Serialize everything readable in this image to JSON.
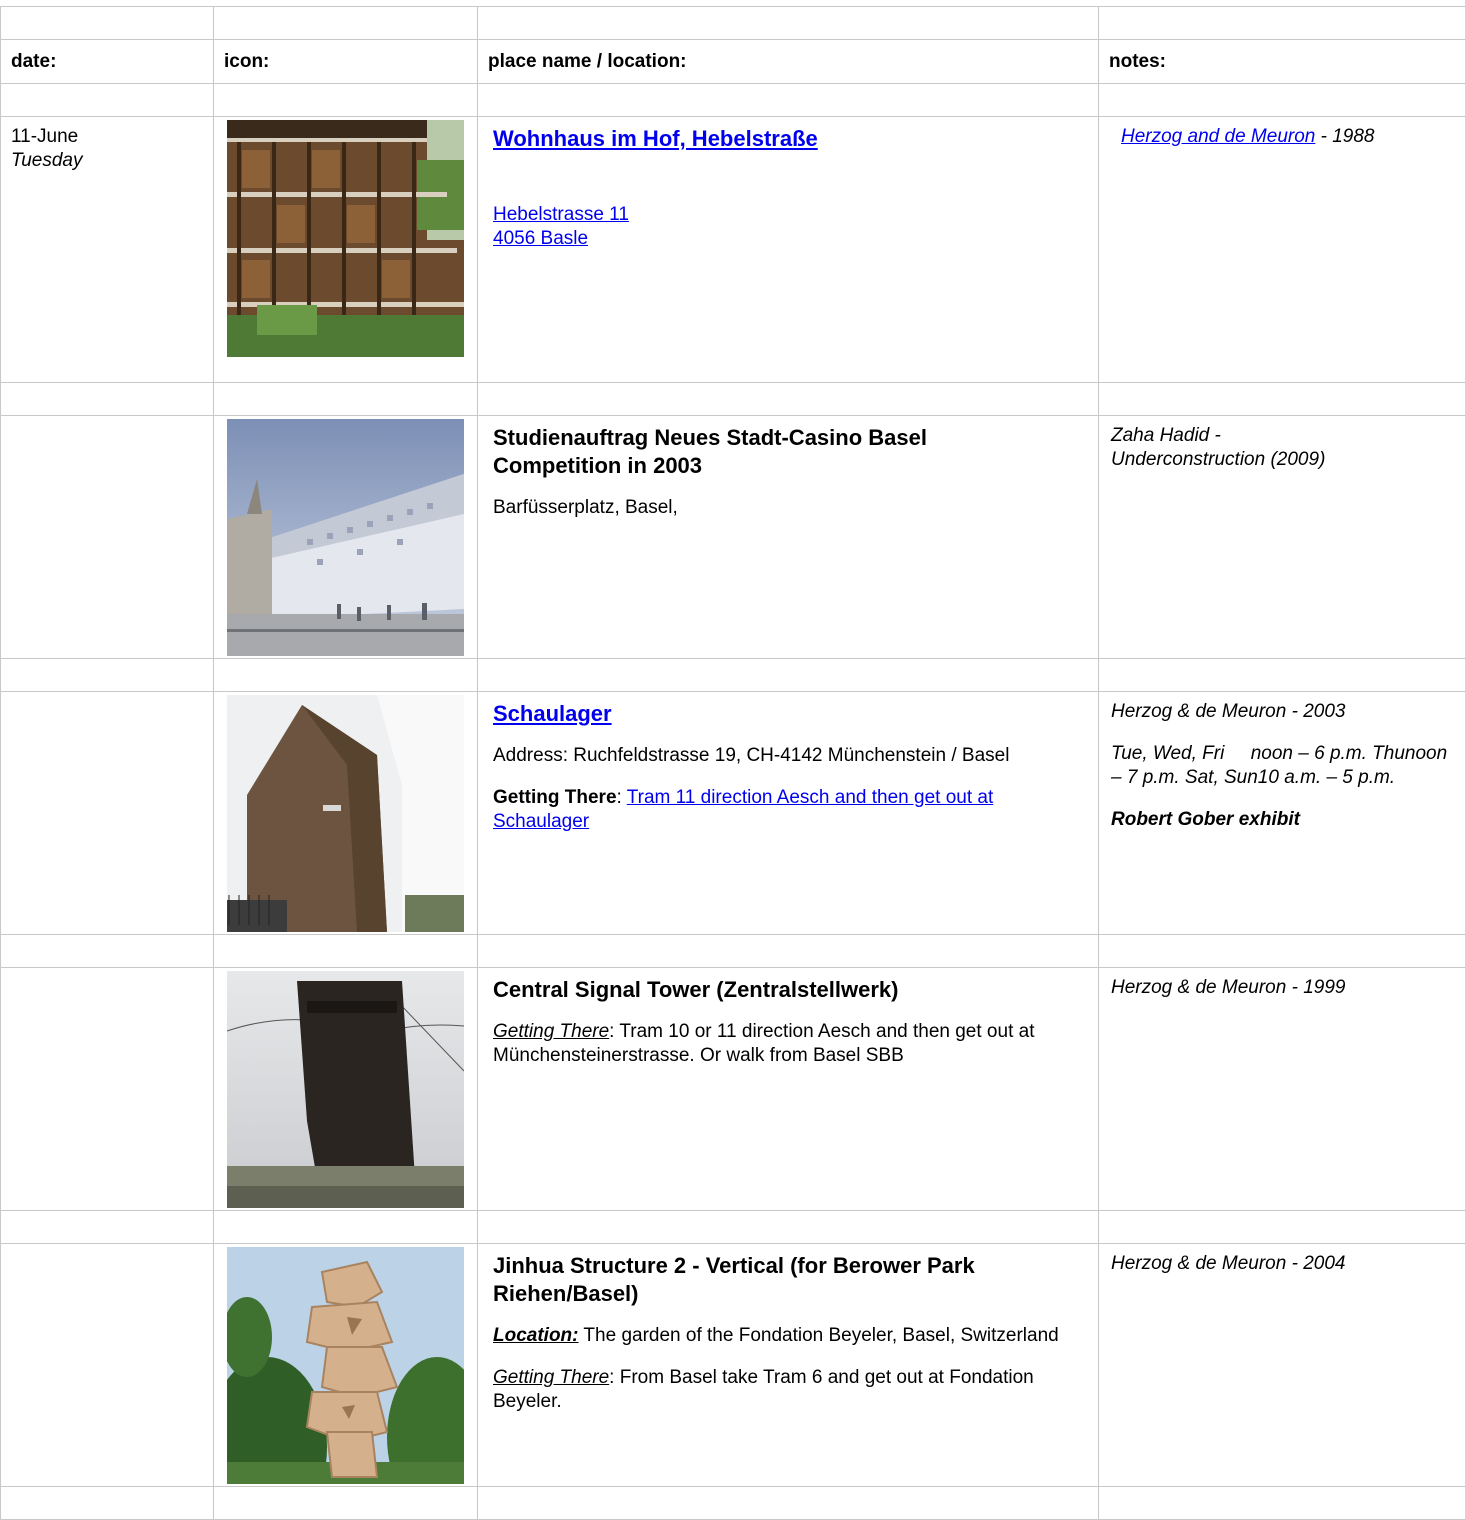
{
  "headers": {
    "date": "date:",
    "icon": "icon:",
    "place": "place name / location:",
    "notes": "notes:"
  },
  "entries": [
    {
      "date": "11-June",
      "weekday": "Tuesday",
      "image": "building-photo-balconies",
      "title": "Wohnhaus im Hof, Hebelstraße",
      "address_line1": "Hebelstrasse 11",
      "address_line2": "4056 Basle",
      "note_link": "Herzog and de Meuron",
      "note_suffix": " - 1988"
    },
    {
      "image": "building-rendering-casino",
      "title_line1": "Studienauftrag Neues Stadt-Casino Basel",
      "title_line2": "Competition in 2003",
      "address": "Barfüsserplatz, Basel,",
      "note_line1": "Zaha Hadid -",
      "note_line2": "Underconstruction (2009)"
    },
    {
      "image": "building-photo-schaulager",
      "title": "Schaulager",
      "address": "Address: Ruchfeldstrasse 19, CH-4142 Münchenstein / Basel",
      "getting_label": "Getting There",
      "getting_colon": ": ",
      "getting_link": "Tram 11 direction Aesch and then get out at Schaulager",
      "note_1": "Herzog & de Meuron - 2003",
      "note_2": "Tue, Wed, Fri     noon – 6 p.m. Thunoon – 7 p.m. Sat, Sun10 a.m. – 5 p.m.",
      "note_3": "Robert Gober exhibit"
    },
    {
      "image": "building-photo-signal-tower",
      "title": "Central Signal Tower (Zentralstellwerk)",
      "getting_label": "Getting There",
      "getting_text": ": Tram 10 or 11 direction Aesch and then get out at Münchensteinerstrasse. Or walk from Basel SBB",
      "note": "Herzog & de Meuron - 1999"
    },
    {
      "image": "sculpture-photo-jinhua",
      "title": "Jinhua Structure 2 - Vertical (for Berower Park Riehen/Basel)",
      "location_label": "Location:",
      "location_text": " The garden of the Fondation Beyeler, Basel, Switzerland",
      "getting_label": "Getting There",
      "getting_text": ": From Basel take Tram 6 and get out at Fondation Beyeler.",
      "note": "Herzog & de Meuron - 2004"
    }
  ]
}
